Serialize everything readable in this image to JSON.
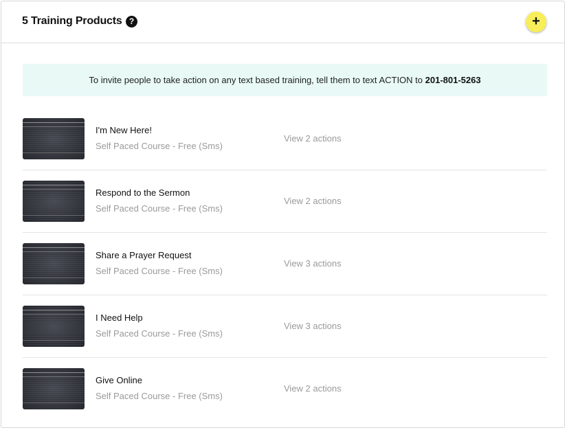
{
  "header": {
    "title": "5 Training Products",
    "help_icon": "?",
    "add_icon": "+"
  },
  "notice": {
    "text": "To invite people to take action on any text based training, tell them to text ACTION to",
    "phone": "201-801-5263"
  },
  "items": [
    {
      "title": "I'm New Here!",
      "subtitle": "Self Paced Course - Free (Sms)",
      "actions": "View 2 actions"
    },
    {
      "title": "Respond to the Sermon",
      "subtitle": "Self Paced Course - Free (Sms)",
      "actions": "View 2 actions"
    },
    {
      "title": "Share a Prayer Request",
      "subtitle": "Self Paced Course - Free (Sms)",
      "actions": "View 3 actions"
    },
    {
      "title": "I Need Help",
      "subtitle": "Self Paced Course - Free (Sms)",
      "actions": "View 3 actions"
    },
    {
      "title": "Give Online",
      "subtitle": "Self Paced Course - Free (Sms)",
      "actions": "View 2 actions"
    }
  ],
  "colors": {
    "add_button": "#f8ee5a",
    "notice_background": "#e8f9f6",
    "muted_text": "#9a9a9a"
  }
}
